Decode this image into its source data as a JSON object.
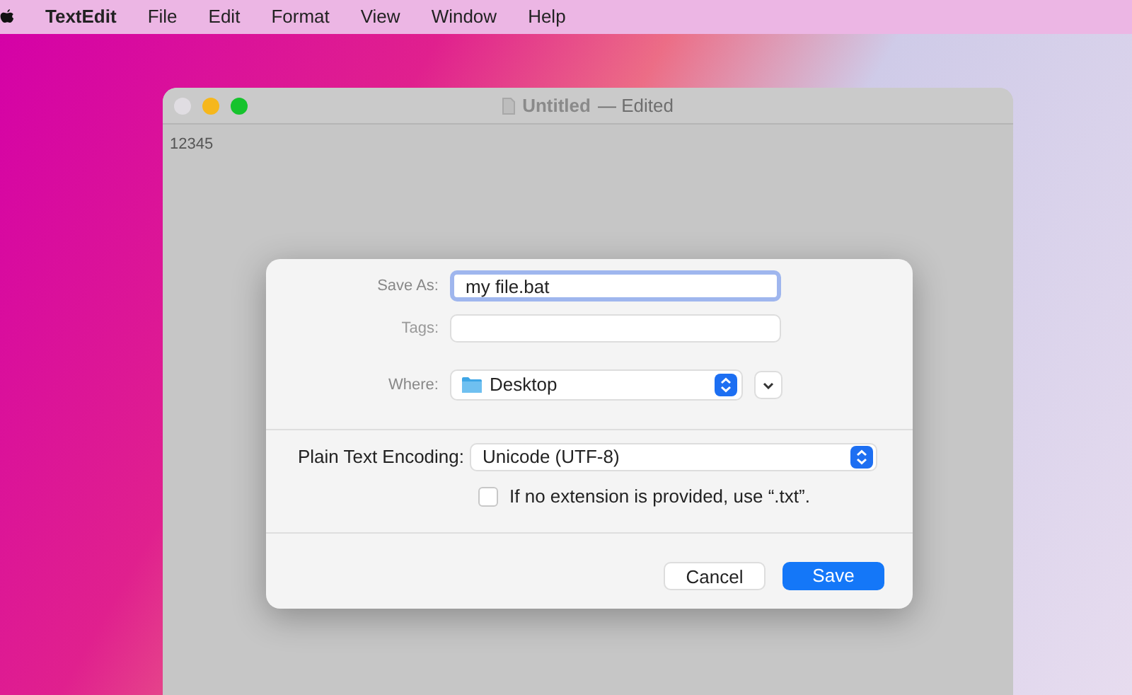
{
  "menu_bar": {
    "items": [
      {
        "label": "TextEdit",
        "kind": "app"
      },
      {
        "label": "File",
        "kind": "menu"
      },
      {
        "label": "Edit",
        "kind": "menu"
      },
      {
        "label": "Format",
        "kind": "menu"
      },
      {
        "label": "View",
        "kind": "menu"
      },
      {
        "label": "Window",
        "kind": "menu"
      },
      {
        "label": "Help",
        "kind": "menu"
      }
    ]
  },
  "window": {
    "title": "Untitled",
    "status": "— Edited",
    "document_text": "12345"
  },
  "save_dialog": {
    "save_as": {
      "label": "Save As:",
      "value": "my file.bat"
    },
    "tags": {
      "label": "Tags:"
    },
    "where": {
      "label": "Where:",
      "value": "Desktop"
    },
    "encoding": {
      "label": "Plain Text Encoding:",
      "value": "Unicode (UTF-8)"
    },
    "extension_option": {
      "label": "If no extension is provided, use “.txt”.",
      "checked": false
    },
    "buttons": [
      {
        "label": "Cancel",
        "kind": "secondary"
      },
      {
        "label": "Save",
        "kind": "primary"
      }
    ]
  }
}
